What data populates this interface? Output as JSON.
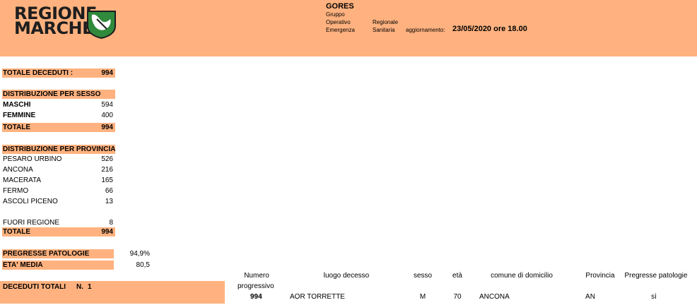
{
  "header": {
    "logo_line1": "REGIONE",
    "logo_line2": "MARCHE",
    "title": "GORES",
    "subtitle_col1": [
      "Gruppo",
      "Operativo",
      "Emergenza"
    ],
    "subtitle_col2": [
      "Regionale",
      "Sanitaria"
    ],
    "update_label": "aggiornamento:",
    "update_value": "23/05/2020 ore 18.00",
    "colors": {
      "band": "#ffb27f",
      "logo_green": "#2f8a3c"
    }
  },
  "totale_deceduti": {
    "label": "TOTALE DECEDUTI :",
    "value": "994"
  },
  "sesso": {
    "title": "DISTRIBUZIONE PER SESSO",
    "rows": [
      {
        "label": "MASCHI",
        "value": "594"
      },
      {
        "label": "FEMMINE",
        "value": "400"
      }
    ],
    "total": {
      "label": "TOTALE",
      "value": "994"
    }
  },
  "provincia": {
    "title": "DISTRIBUZIONE PER PROVINCIA",
    "rows": [
      {
        "label": "PESARO URBINO",
        "value": "526"
      },
      {
        "label": "ANCONA",
        "value": "216"
      },
      {
        "label": "MACERATA",
        "value": "165"
      },
      {
        "label": "FERMO",
        "value": "66"
      },
      {
        "label": "ASCOLI PICENO",
        "value": "13"
      }
    ],
    "fuori": {
      "label": "FUORI REGIONE",
      "value": "8"
    },
    "total": {
      "label": "TOTALE",
      "value": "994"
    }
  },
  "patologie": {
    "label": "PREGRESSE PATOLOGIE",
    "value": "94,9%"
  },
  "eta_media": {
    "label": "ETA' MEDIA",
    "value": "80,5"
  },
  "deceduti_totali": {
    "label": "DECEDUTI TOTALI",
    "n_label": "N.",
    "n_value": "1"
  },
  "table": {
    "headers": {
      "numero_line1": "Numero",
      "numero_line2": "progressivo",
      "luogo": "luogo decesso",
      "sesso": "sesso",
      "eta": "età",
      "comune": "comune di domicilio",
      "provincia": "Provincia",
      "patologie": "Pregresse patologie"
    },
    "row": {
      "numero": "994",
      "luogo": "AOR TORRETTE",
      "sesso": "M",
      "eta": "70",
      "comune": "ANCONA",
      "provincia": "AN",
      "patologie": "sì"
    }
  }
}
